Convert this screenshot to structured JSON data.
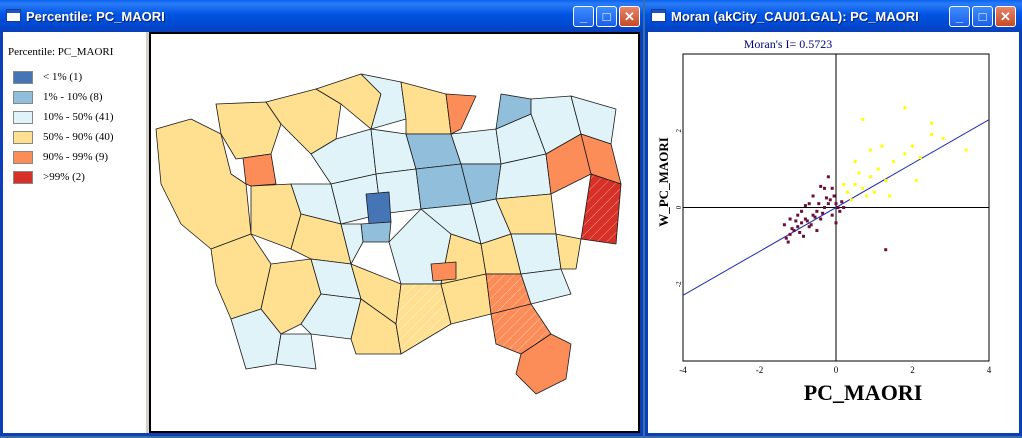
{
  "left_window": {
    "title": "Percentile: PC_MAORI",
    "legend_title": "Percentile: PC_MAORI",
    "legend": [
      {
        "label": "< 1% (1)",
        "color": "#4575b4"
      },
      {
        "label": "1% - 10% (8)",
        "color": "#91bfdb"
      },
      {
        "label": "10% - 50% (41)",
        "color": "#e0f3f8"
      },
      {
        "label": "50% - 90% (40)",
        "color": "#fee090"
      },
      {
        "label": "90% - 99% (9)",
        "color": "#fc8d59"
      },
      {
        "label": ">99% (2)",
        "color": "#d73027"
      }
    ],
    "buttons": {
      "minimize": "_",
      "maximize": "□",
      "close": "✕"
    }
  },
  "right_window": {
    "title": "Moran (akCity_CAU01.GAL): PC_MAORI",
    "buttons": {
      "minimize": "_",
      "maximize": "□",
      "close": "✕"
    }
  },
  "chart_data": {
    "type": "scatter",
    "title": "Moran's I= 0.5723",
    "xlabel": "PC_MAORI",
    "ylabel": "W_PC_MAORI",
    "xlim": [
      -4,
      4
    ],
    "ylim": [
      -4,
      4
    ],
    "x_ticks": [
      "-4",
      "-2",
      "0",
      "2",
      "4"
    ],
    "y_ticks": [
      "2",
      "0",
      "-2"
    ],
    "regression": {
      "slope": 0.5723,
      "intercept": 0
    },
    "series": [
      {
        "color": "#6b0f3a",
        "points": [
          [
            -1.3,
            -0.8
          ],
          [
            -1.2,
            -0.7
          ],
          [
            -1.1,
            -0.6
          ],
          [
            -1.0,
            -0.5
          ],
          [
            -0.9,
            -0.4
          ],
          [
            -1.2,
            -0.3
          ],
          [
            -1.0,
            -0.2
          ],
          [
            -0.8,
            -0.3
          ],
          [
            -0.7,
            -0.5
          ],
          [
            -0.6,
            -0.2
          ],
          [
            -0.5,
            -0.1
          ],
          [
            -0.4,
            -0.3
          ],
          [
            -0.3,
            0.0
          ],
          [
            -0.2,
            0.1
          ],
          [
            -0.1,
            -0.2
          ],
          [
            0.0,
            0.1
          ],
          [
            0.1,
            -0.1
          ],
          [
            0.2,
            0.0
          ],
          [
            -1.25,
            -0.9
          ],
          [
            -1.15,
            -0.55
          ],
          [
            -0.95,
            -0.65
          ],
          [
            -0.85,
            -0.75
          ],
          [
            -0.75,
            -0.35
          ],
          [
            -0.65,
            -0.45
          ],
          [
            -0.55,
            -0.25
          ],
          [
            -0.45,
            0.1
          ],
          [
            -0.35,
            -0.15
          ],
          [
            -0.25,
            0.25
          ],
          [
            -0.15,
            0.2
          ],
          [
            -0.05,
            0.3
          ],
          [
            0.05,
            0.0
          ],
          [
            0.15,
            0.15
          ],
          [
            -0.3,
            0.5
          ],
          [
            -0.2,
            0.8
          ],
          [
            -0.6,
            0.3
          ],
          [
            -0.9,
            -0.1
          ],
          [
            -1.05,
            -0.35
          ],
          [
            -0.5,
            -0.6
          ],
          [
            0.0,
            -0.4
          ],
          [
            -0.1,
            0.5
          ],
          [
            1.3,
            -1.1
          ],
          [
            -1.35,
            -0.45
          ],
          [
            -0.4,
            0.55
          ],
          [
            -0.7,
            0.1
          ],
          [
            -0.8,
            0.05
          ]
        ]
      },
      {
        "color": "#ffff00",
        "points": [
          [
            0.3,
            0.4
          ],
          [
            0.5,
            0.6
          ],
          [
            0.7,
            0.5
          ],
          [
            0.9,
            0.8
          ],
          [
            1.1,
            1.0
          ],
          [
            1.3,
            0.7
          ],
          [
            1.5,
            1.2
          ],
          [
            1.8,
            1.4
          ],
          [
            2.0,
            1.6
          ],
          [
            2.2,
            1.3
          ],
          [
            2.5,
            1.9
          ],
          [
            2.8,
            1.8
          ],
          [
            3.4,
            1.5
          ],
          [
            0.7,
            2.3
          ],
          [
            1.8,
            2.6
          ],
          [
            2.5,
            2.2
          ],
          [
            1.2,
            1.6
          ],
          [
            0.6,
            0.9
          ],
          [
            0.4,
            0.2
          ],
          [
            0.2,
            0.6
          ],
          [
            0.8,
            0.3
          ],
          [
            1.0,
            0.4
          ],
          [
            2.1,
            0.7
          ],
          [
            1.4,
            0.3
          ],
          [
            0.5,
            1.2
          ],
          [
            0.9,
            1.5
          ]
        ]
      }
    ]
  }
}
